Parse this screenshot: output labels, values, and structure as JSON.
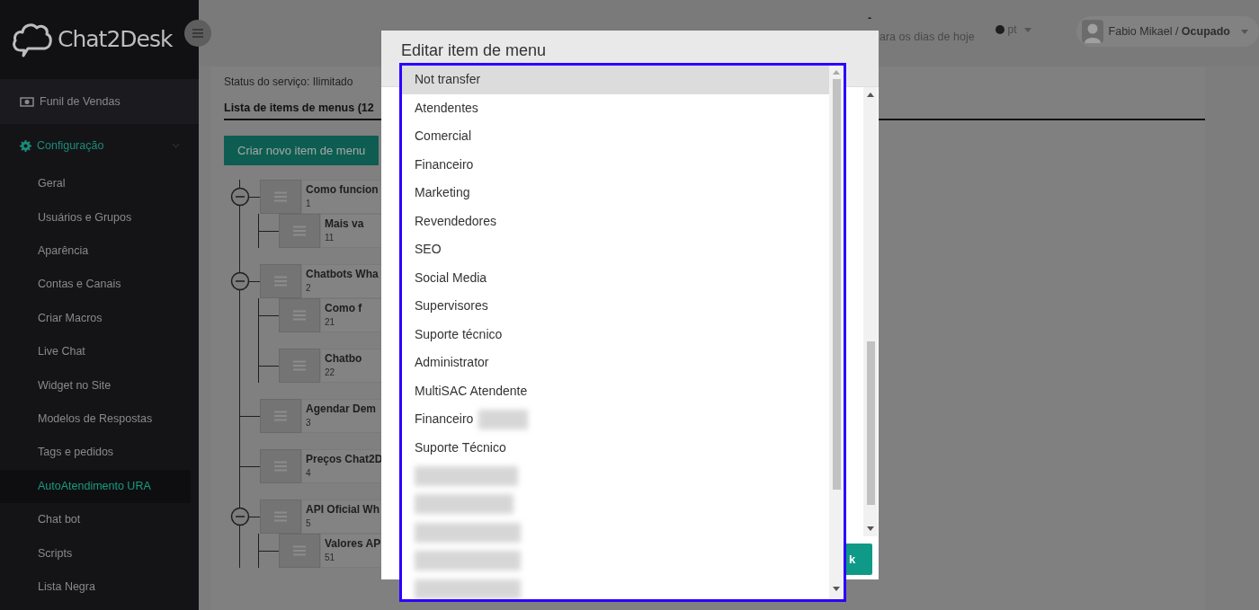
{
  "sidebar": {
    "logo": "Chat2Desk",
    "items": [
      {
        "label": "Funil de Vendas",
        "kind": "link",
        "selected": false
      },
      {
        "label": "Configuração",
        "kind": "section",
        "selected": true,
        "expanded": true,
        "children": [
          {
            "label": "Geral",
            "selected": false
          },
          {
            "label": "Usuários e Grupos",
            "selected": false
          },
          {
            "label": "Aparência",
            "selected": false
          },
          {
            "label": "Contas e Canais",
            "selected": false
          },
          {
            "label": "Criar Macros",
            "selected": false
          },
          {
            "label": "Live Chat",
            "selected": false
          },
          {
            "label": "Widget no Site",
            "selected": false
          },
          {
            "label": "Modelos de Respostas",
            "selected": false
          },
          {
            "label": "Tags e pedidos",
            "selected": false
          },
          {
            "label": "AutoAtendimento URA",
            "selected": true
          },
          {
            "label": "Chat bot",
            "selected": false
          },
          {
            "label": "Scripts",
            "selected": false
          },
          {
            "label": "Lista Negra",
            "selected": false
          }
        ]
      }
    ]
  },
  "header": {
    "note_mark": "-",
    "note": "ara os dias de hoje",
    "language": "pt",
    "user": "Fabio Mikael / **Ocupado**"
  },
  "content": {
    "status": "Status do serviço: Ilimitado",
    "list_title": "Lista de items de menus (12",
    "create_button": "Criar novo item de menu",
    "tree": [
      {
        "title": "Como funcion",
        "number": "1",
        "children": [
          {
            "title": "Mais va",
            "number": "11"
          }
        ]
      },
      {
        "title": "Chatbots Wha",
        "number": "2",
        "children": [
          {
            "title": "Como f",
            "number": "21"
          },
          {
            "title": "Chatbo",
            "number": "22"
          }
        ]
      },
      {
        "title": "Agendar Dem",
        "number": "3"
      },
      {
        "title": "Preços Chat2D",
        "number": "4"
      },
      {
        "title": "API Oficial Wh",
        "number": "5",
        "children": [
          {
            "title": "Valores AP",
            "number": "51"
          }
        ]
      }
    ]
  },
  "modal": {
    "title": "Editar item de menu",
    "ok_button": "k"
  },
  "dropdown": {
    "options": [
      {
        "label": "Not transfer",
        "selected": true
      },
      {
        "label": "Atendentes",
        "selected": false
      },
      {
        "label": "Comercial",
        "selected": false
      },
      {
        "label": "Financeiro",
        "selected": false
      },
      {
        "label": "Marketing",
        "selected": false
      },
      {
        "label": "Revendedores",
        "selected": false
      },
      {
        "label": "SEO",
        "selected": false
      },
      {
        "label": "Social Media",
        "selected": false
      },
      {
        "label": "Supervisores",
        "selected": false
      },
      {
        "label": "Suporte técnico",
        "selected": false
      },
      {
        "label": "Administrator",
        "selected": false
      },
      {
        "label": "MultiSAC Atendente",
        "selected": false
      },
      {
        "label": "Financeiro",
        "selected": false,
        "redacted": true
      },
      {
        "label": "Suporte Técnico",
        "selected": false
      },
      {
        "kind": "redacted",
        "selected": false
      },
      {
        "kind": "redacted",
        "selected": false
      },
      {
        "kind": "redacted",
        "selected": false
      },
      {
        "kind": "redacted",
        "selected": false
      },
      {
        "kind": "redacted",
        "selected": false
      }
    ]
  }
}
